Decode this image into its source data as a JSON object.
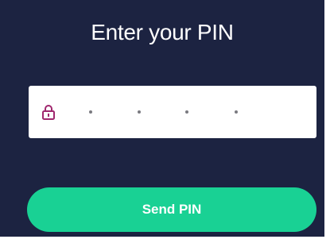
{
  "title": "Enter your PIN",
  "pin_field": {
    "lock_icon": "lock-icon",
    "masked_digits": [
      "•",
      "•",
      "•",
      "•"
    ]
  },
  "send_button": {
    "label": "Send PIN"
  },
  "colors": {
    "background": "#1c2341",
    "field": "#ffffff",
    "button": "#19d194",
    "lock_icon": "#a0286e",
    "dot": "#7a7a80"
  }
}
